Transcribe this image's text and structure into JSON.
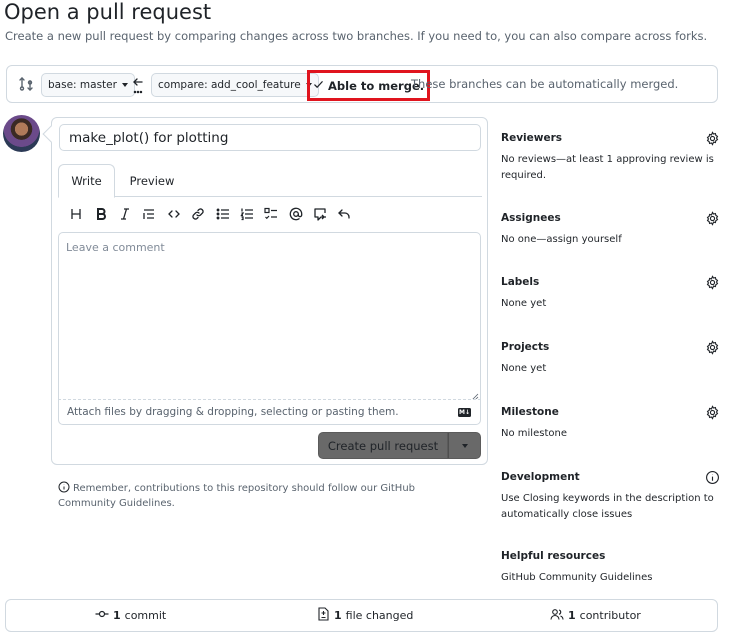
{
  "header": {
    "title": "Open a pull request",
    "subtitle": "Create a new pull request by comparing changes across two branches. If you need to, you can also compare across forks."
  },
  "compare": {
    "base_label": "base: master",
    "compare_label": "compare: add_cool_feature",
    "merge_status": "Able to merge.",
    "merge_detail": "These branches can be automatically merged.",
    "merge_highlight_color": "#e0141e"
  },
  "composer": {
    "title_value": "make_plot() for plotting",
    "tabs": [
      {
        "label": "Write",
        "active": true
      },
      {
        "label": "Preview",
        "active": false
      }
    ],
    "toolbar_icons": [
      "heading-icon",
      "bold-icon",
      "italic-icon",
      "quote-icon",
      "code-icon",
      "link-icon",
      "unordered-list-icon",
      "ordered-list-icon",
      "task-list-icon",
      "mention-icon",
      "reference-icon",
      "undo-icon"
    ],
    "comment_placeholder": "Leave a comment",
    "attach_text": "Attach files by dragging & dropping, selecting or pasting them.",
    "markdown_badge": "M↓",
    "create_label": "Create pull request"
  },
  "remember_text": "Remember, contributions to this repository should follow our GitHub Community Guidelines.",
  "sidebar": {
    "reviewers": {
      "title": "Reviewers",
      "text": "No reviews—at least 1 approving review is required."
    },
    "assignees": {
      "title": "Assignees",
      "text": "No one—assign yourself"
    },
    "labels": {
      "title": "Labels",
      "text": "None yet"
    },
    "projects": {
      "title": "Projects",
      "text": "None yet"
    },
    "milestone": {
      "title": "Milestone",
      "text": "No milestone"
    },
    "development": {
      "title": "Development",
      "text": "Use Closing keywords in the description to automatically close issues"
    },
    "helpful": {
      "title": "Helpful resources",
      "text": "GitHub Community Guidelines"
    }
  },
  "footer": {
    "commits_count": "1",
    "commits_label": "commit",
    "files_count": "1",
    "files_label": "file changed",
    "contributors_count": "1",
    "contributors_label": "contributor"
  }
}
